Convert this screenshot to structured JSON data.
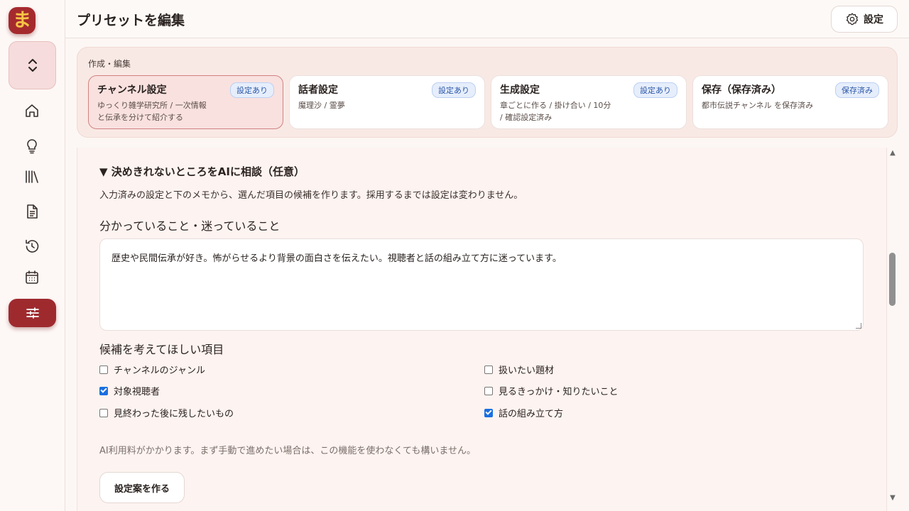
{
  "app": {
    "logo_char": "ま"
  },
  "header": {
    "title": "プリセットを編集",
    "settings_label": "設定"
  },
  "steps": {
    "label": "作成・編集",
    "items": [
      {
        "title": "チャンネル設定",
        "badge": "設定あり",
        "desc1": "ゆっくり雑学研究所 / 一次情報",
        "desc2": "と伝承を分けて紹介する",
        "active": true
      },
      {
        "title": "話者設定",
        "badge": "設定あり",
        "desc1": "魔理沙 / 霊夢",
        "desc2": ""
      },
      {
        "title": "生成設定",
        "badge": "設定あり",
        "desc1": "章ごとに作る / 掛け合い / 10分",
        "desc2": "/ 確認設定済み"
      },
      {
        "title": "保存（保存済み）",
        "badge": "保存済み",
        "desc1": "都市伝説チャンネル を保存済み",
        "desc2": ""
      }
    ]
  },
  "ai": {
    "heading": "▼ 決めきれないところをAIに相談（任意）",
    "sub": "入力済みの設定と下のメモから、選んだ項目の候補を作ります。採用するまでは設定は変わりません。",
    "memo_label": "分かっていること・迷っていること",
    "memo_value": "歴史や民間伝承が好き。怖がらせるより背景の面白さを伝えたい。視聴者と話の組み立て方に迷っています。",
    "candidates_label": "候補を考えてほしい項目",
    "options": [
      {
        "label": "チャンネルのジャンル",
        "checked": false
      },
      {
        "label": "扱いたい題材",
        "checked": false
      },
      {
        "label": "対象視聴者",
        "checked": true
      },
      {
        "label": "見るきっかけ・知りたいこと",
        "checked": false
      },
      {
        "label": "見終わった後に残したいもの",
        "checked": false
      },
      {
        "label": "話の組み立て方",
        "checked": true
      }
    ],
    "note": "AI利用料がかかります。まず手動で進めたい場合は、この機能を使わなくても構いません。",
    "make_button": "設定案を作る"
  },
  "colors": {
    "accent": "#9e2a2e",
    "badge_blue": "#2c57a8",
    "checkbox": "#1a6fe0"
  },
  "icons": [
    "home-icon",
    "lightbulb-icon",
    "library-icon",
    "document-icon",
    "history-icon",
    "calendar-icon",
    "sliders-icon"
  ]
}
